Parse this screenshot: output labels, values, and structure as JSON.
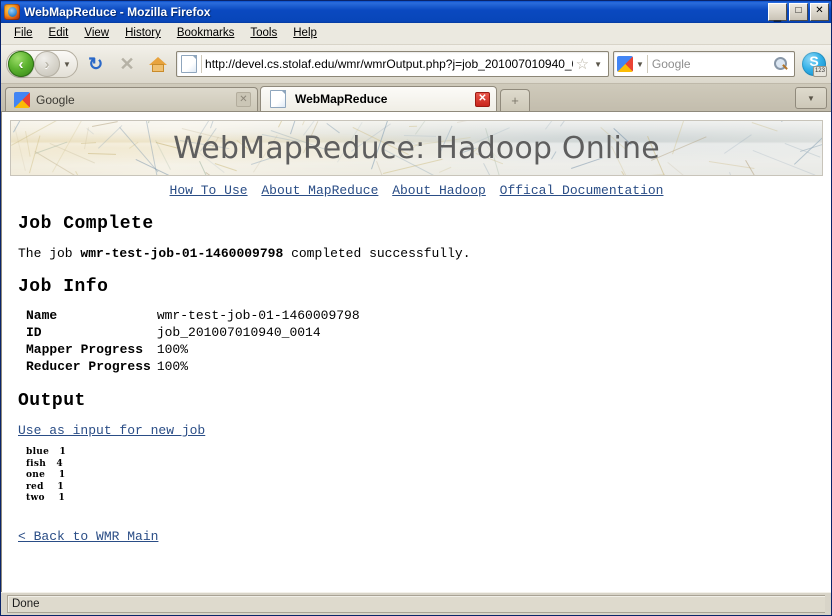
{
  "window": {
    "title": "WebMapReduce - Mozilla Firefox",
    "app_icon": "firefox-icon",
    "minimize_label": "_",
    "maximize_label": "□",
    "close_label": "✕"
  },
  "menubar": {
    "items": [
      {
        "label": "File",
        "accel": "F"
      },
      {
        "label": "Edit",
        "accel": "E"
      },
      {
        "label": "View",
        "accel": "V"
      },
      {
        "label": "History",
        "accel": "s"
      },
      {
        "label": "Bookmarks",
        "accel": "B"
      },
      {
        "label": "Tools",
        "accel": "T"
      },
      {
        "label": "Help",
        "accel": "H"
      }
    ]
  },
  "toolbar": {
    "back_label": "‹",
    "forward_label": "›",
    "history_dropdown_label": "▼",
    "reload_label": "↻",
    "stop_label": "✕",
    "home_icon": "home-icon",
    "url": "http://devel.cs.stolaf.edu/wmr/wmrOutput.php?j=job_201007010940_0(",
    "bookmark_star": "☆",
    "url_dropdown_label": "▼",
    "search_placeholder": "Google",
    "search_engine_icon": "google-icon",
    "search_dropdown_label": "▼",
    "search_go_icon": "magnifier-icon",
    "skype_icon": "skype-icon",
    "skype_badge": "123"
  },
  "tabs": {
    "items": [
      {
        "label": "Google",
        "icon": "google-icon",
        "active": false,
        "close_label": "✕"
      },
      {
        "label": "WebMapReduce",
        "icon": "page-icon",
        "active": true,
        "close_label": "✕"
      }
    ],
    "new_tab_label": "+",
    "tab_list_dropdown_label": "▼"
  },
  "page": {
    "banner_title": "WebMapReduce: Hadoop Online",
    "nav_links": [
      "How To Use",
      "About MapReduce",
      "About Hadoop",
      "Offical Documentation"
    ],
    "heading_job_complete": "Job Complete",
    "job_message_prefix": "The job ",
    "job_message_name": "wmr-test-job-01-1460009798",
    "job_message_suffix": " completed successfully.",
    "heading_job_info": "Job Info",
    "job_info": [
      {
        "key": "Name",
        "value": "wmr-test-job-01-1460009798"
      },
      {
        "key": "ID",
        "value": "job_201007010940_0014"
      },
      {
        "key": "Mapper Progress",
        "value": "100%"
      },
      {
        "key": "Reducer Progress",
        "value": "100%"
      }
    ],
    "heading_output": "Output",
    "use_as_input_link": "Use as input for new job",
    "output_rows": [
      {
        "key": "blue",
        "value": "1"
      },
      {
        "key": "fish",
        "value": "4"
      },
      {
        "key": "one",
        "value": "1"
      },
      {
        "key": "red",
        "value": "1"
      },
      {
        "key": "two",
        "value": "1"
      }
    ],
    "back_link": "< Back to WMR Main",
    "link_color": "#2a4d86"
  },
  "statusbar": {
    "text": "Done"
  }
}
